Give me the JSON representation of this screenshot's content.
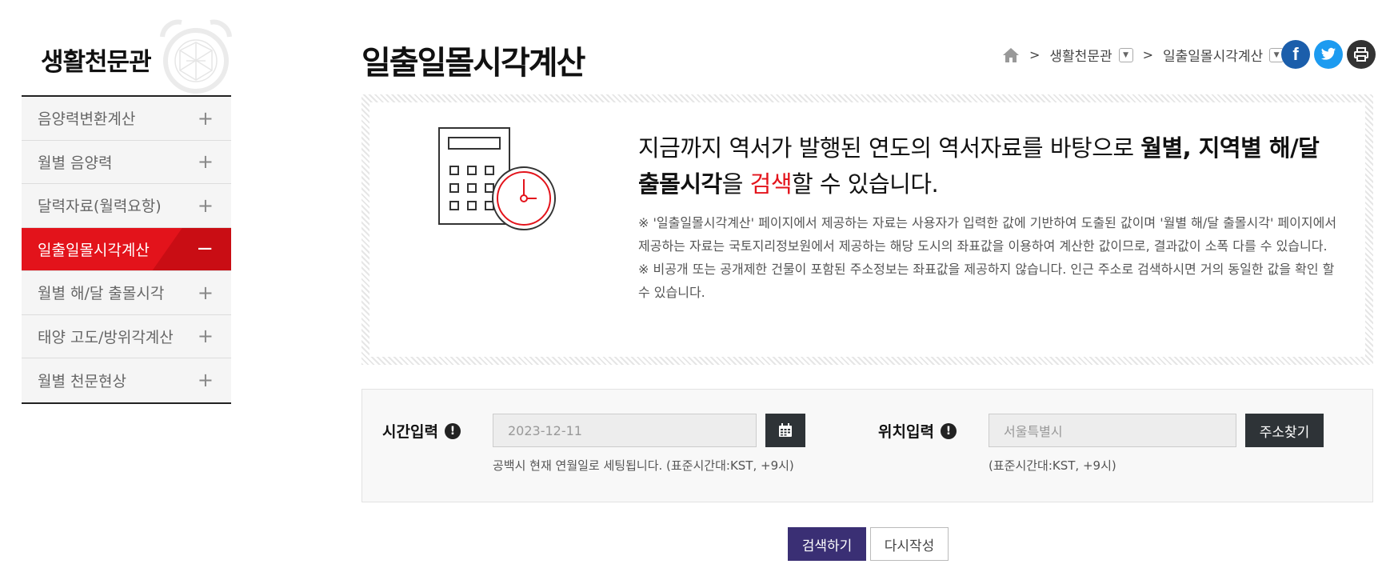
{
  "sidebar": {
    "title": "생활천문관",
    "items": [
      {
        "label": "음양력변환계산",
        "toggle": "+"
      },
      {
        "label": "월별 음양력",
        "toggle": "+"
      },
      {
        "label": "달력자료(월력요항)",
        "toggle": "+"
      },
      {
        "label": "일출일몰시각계산",
        "toggle": "−",
        "active": true
      },
      {
        "label": "월별 해/달 출몰시각",
        "toggle": "+"
      },
      {
        "label": "태양 고도/방위각계산",
        "toggle": "+"
      },
      {
        "label": "월별 천문현상",
        "toggle": "+"
      }
    ]
  },
  "header": {
    "title": "일출일몰시각계산",
    "breadcrumb": {
      "home_icon": "home-icon",
      "sep": ">",
      "level1": "생활천문관",
      "level2": "일출일몰시각계산"
    },
    "social": {
      "facebook": "f",
      "twitter": "twitter-icon",
      "print": "print-icon",
      "facebook_color": "#1b5eab",
      "twitter_color": "#1d9bf0",
      "print_color": "#333333"
    }
  },
  "info": {
    "headline_part1": "지금까지 역서가 발행된 연도의 역서자료를 바탕으로 ",
    "headline_bold1": "월별, 지역별 해/달 출몰시각",
    "headline_part2": "을 ",
    "headline_red": "검색",
    "headline_part3": "할 수 있습니다.",
    "note1": "※ '일출일몰시각계산' 페이지에서 제공하는 자료는 사용자가 입력한 값에 기반하여 도출된 값이며 '월별 해/달 출몰시각' 페이지에서 제공하는 자료는 국토지리정보원에서 제공하는 해당 도시의 좌표값을 이용하여 계산한 값이므로, 결과값이 소폭 다를 수 있습니다.",
    "note2": "※ 비공개 또는 공개제한 건물이 포함된 주소정보는 좌표값을 제공하지 않습니다. 인근 주소로 검색하시면 거의 동일한 값을 확인 할 수 있습니다."
  },
  "search": {
    "time_label": "시간입력",
    "time_value": "2023-12-11",
    "time_hint": "공백시 현재 연월일로 세팅됩니다. (표준시간대:KST, +9시)",
    "location_label": "위치입력",
    "location_value": "서울특별시",
    "location_hint": "(표준시간대:KST, +9시)",
    "address_button": "주소찾기",
    "info_mark": "!"
  },
  "actions": {
    "search_button": "검색하기",
    "reset_button": "다시작성"
  },
  "colors": {
    "accent_red": "#e3131b",
    "primary_purple": "#3a2f74",
    "dark_button": "#2e3337"
  }
}
